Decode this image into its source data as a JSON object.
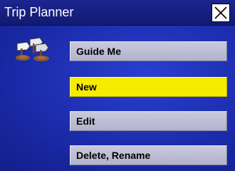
{
  "window": {
    "title": "Trip Planner",
    "close_icon": "close-icon"
  },
  "app_icon": "trip-planner-icon",
  "menu": {
    "items": [
      {
        "label": "Guide Me",
        "selected": false
      },
      {
        "label": "New",
        "selected": true
      },
      {
        "label": "Edit",
        "selected": false
      },
      {
        "label": "Delete, Rename",
        "selected": false
      }
    ]
  },
  "colors": {
    "background": "#1a2aa8",
    "titlebar": "#1d2590",
    "button": "#c0c0d6",
    "selected_button": "#f7ec00"
  }
}
